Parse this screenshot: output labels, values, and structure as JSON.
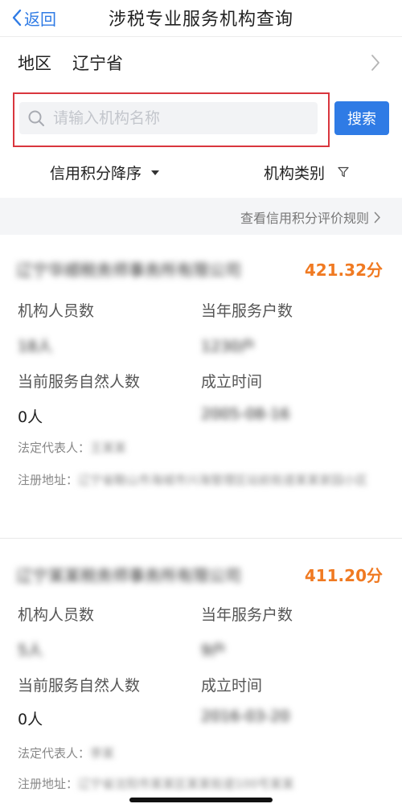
{
  "nav": {
    "back_label": "返回",
    "title": "涉税专业服务机构查询"
  },
  "region": {
    "label": "地区",
    "value": "辽宁省"
  },
  "search": {
    "placeholder": "请输入机构名称",
    "value": "",
    "button_label": "搜索"
  },
  "filters": {
    "sort_label": "信用积分降序",
    "type_label": "机构类别"
  },
  "rules_link": "查看信用积分评价规则",
  "records": [
    {
      "org_name": "辽宁华顺税务师事务所有限公司",
      "score": "421.32分",
      "staff_label": "机构人员数",
      "staff_value": "18人",
      "clients_label": "当年服务户数",
      "clients_value": "1230户",
      "persons_label": "当前服务自然人数",
      "persons_value": "0人",
      "founded_label": "成立时间",
      "founded_value": "2005-08-16",
      "legal_label": "法定代表人：",
      "legal_value": "王某某",
      "address_label": "注册地址：",
      "address_value": "辽宁省鞍山市海城市兴海管理区站前街道某某家园小区"
    },
    {
      "org_name": "辽宁某某税务师事务所有限公司",
      "score": "411.20分",
      "staff_label": "机构人员数",
      "staff_value": "5人",
      "clients_label": "当年服务户数",
      "clients_value": "9户",
      "persons_label": "当前服务自然人数",
      "persons_value": "0人",
      "founded_label": "成立时间",
      "founded_value": "2016-03-20",
      "legal_label": "法定代表人：",
      "legal_value": "李某",
      "address_label": "注册地址：",
      "address_value": "辽宁省沈阳市某某区某某街道100号某某"
    }
  ]
}
